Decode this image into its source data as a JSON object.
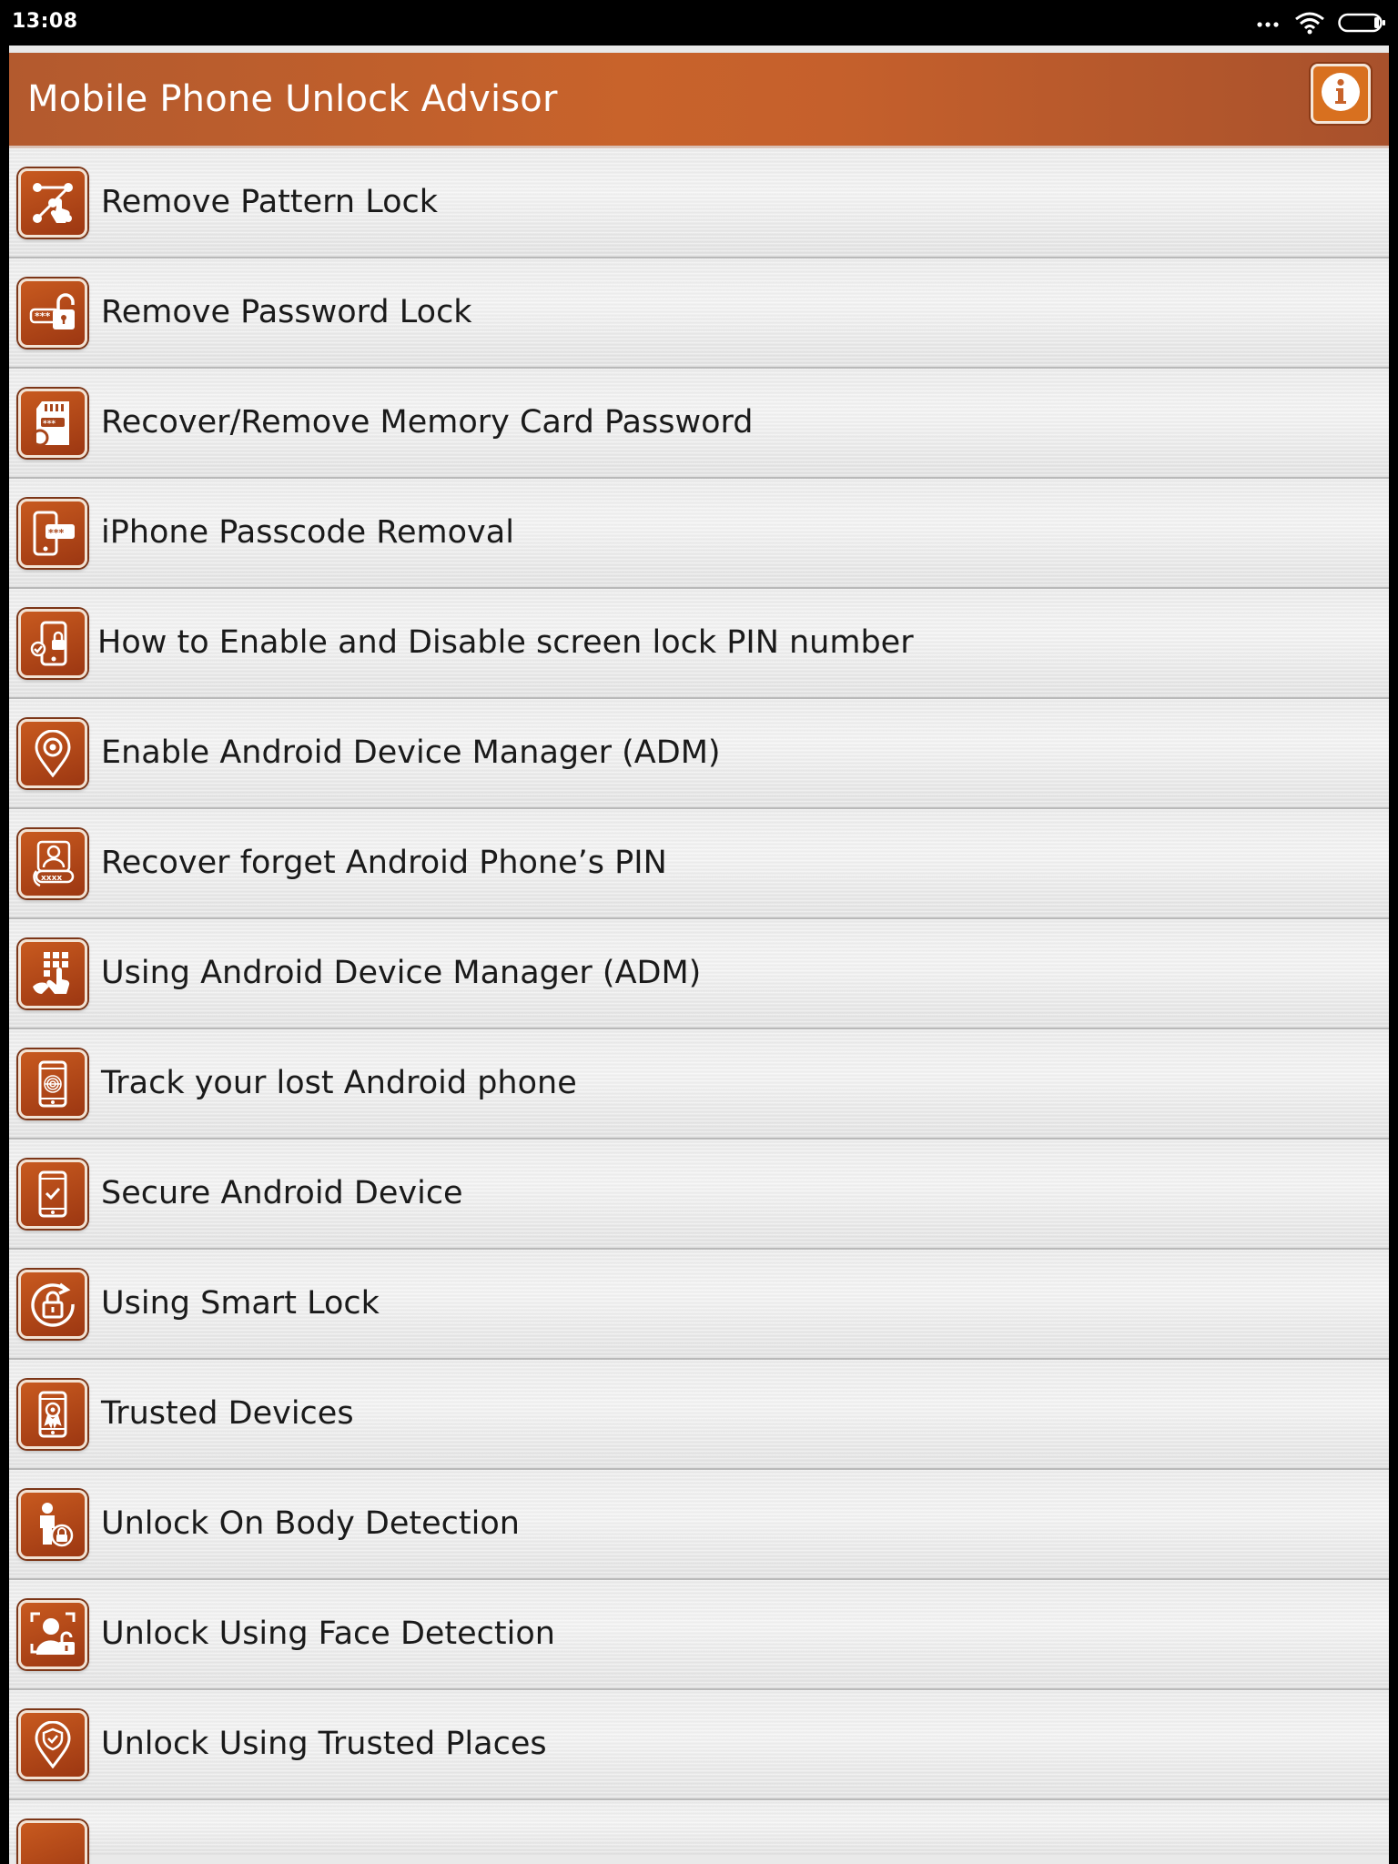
{
  "status_bar": {
    "time": "13:08",
    "icons": [
      "dots-icon",
      "wifi-icon",
      "battery-icon"
    ]
  },
  "app_bar": {
    "title": "Mobile Phone Unlock Advisor",
    "info_icon": "info-icon"
  },
  "colors": {
    "accent": "#c5602c",
    "icon_bg": "#b2461a",
    "list_bg": "#ececec"
  },
  "menu": {
    "items": [
      {
        "label": "Remove Pattern Lock",
        "icon": "pattern-lock-icon"
      },
      {
        "label": "Remove Password Lock",
        "icon": "password-lock-icon"
      },
      {
        "label": "Recover/Remove Memory Card Password",
        "icon": "memory-card-icon"
      },
      {
        "label": "iPhone Passcode Removal",
        "icon": "phone-passcode-icon"
      },
      {
        "label": "How to Enable and Disable screen lock PIN number",
        "icon": "phone-lock-icon"
      },
      {
        "label": "Enable Android Device Manager (ADM)",
        "icon": "location-pin-icon"
      },
      {
        "label": "Recover forget Android Phone’s PIN",
        "icon": "user-pin-icon"
      },
      {
        "label": "Using Android Device Manager (ADM)",
        "icon": "keypad-hand-icon"
      },
      {
        "label": "Track your lost Android phone",
        "icon": "phone-fingerprint-icon"
      },
      {
        "label": "Secure Android Device",
        "icon": "phone-check-icon"
      },
      {
        "label": "Using Smart Lock",
        "icon": "smart-lock-icon"
      },
      {
        "label": "Trusted Devices",
        "icon": "trusted-device-icon"
      },
      {
        "label": "Unlock On Body Detection",
        "icon": "body-detection-icon"
      },
      {
        "label": "Unlock Using Face Detection",
        "icon": "face-detection-icon"
      },
      {
        "label": "Unlock Using Trusted Places",
        "icon": "trusted-place-icon"
      }
    ]
  }
}
